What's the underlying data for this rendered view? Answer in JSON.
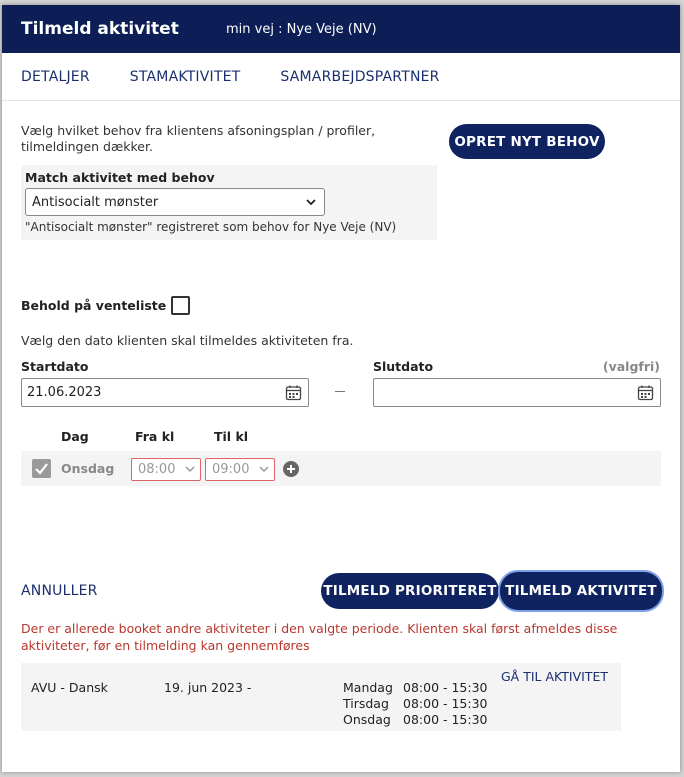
{
  "header": {
    "title": "Tilmeld aktivitet",
    "subtitle": "min vej : Nye Veje (NV)"
  },
  "tabs": [
    {
      "label": "DETALJER"
    },
    {
      "label": "STAMAKTIVITET"
    },
    {
      "label": "SAMARBEJDSPARTNER"
    }
  ],
  "intro_text": "Vælg hvilket behov fra klientens afsoningsplan / profiler, tilmeldingen dækker.",
  "match": {
    "label": "Match aktivitet med behov",
    "selected": "Antisocialt mønster",
    "note": "\"Antisocialt mønster\" registreret som behov for Nye Veje (NV)"
  },
  "opret_button": "OPRET NYT BEHOV",
  "venteliste_label": "Behold på venteliste",
  "dato_intro": "Vælg den dato klienten skal tilmeldes aktiviteten fra.",
  "startdato": {
    "label": "Startdato",
    "value": "21.06.2023"
  },
  "slutdato": {
    "label": "Slutdato",
    "value": "",
    "optional": "(valgfri)"
  },
  "dash": "–",
  "schedule": {
    "headers": {
      "dag": "Dag",
      "fra": "Fra kl",
      "til": "Til kl"
    },
    "row": {
      "dag": "Onsdag",
      "fra": "08:00",
      "til": "09:00",
      "checked": true
    }
  },
  "footer": {
    "annuller": "ANNULLER",
    "prioriteret": "TILMELD PRIORITERET",
    "tilmeld": "TILMELD AKTIVITET"
  },
  "warning": "Der er allerede booket andre aktiviteter i den valgte periode. Klienten skal først afmeldes disse aktiviteter, før en tilmelding kan gennemføres",
  "booked": {
    "activity": "AVU - Dansk",
    "date": "19. jun 2023 -",
    "days": [
      {
        "day": "Mandag",
        "time": "08:00 - 15:30"
      },
      {
        "day": "Tirsdag",
        "time": "08:00 - 15:30"
      },
      {
        "day": "Onsdag",
        "time": "08:00 - 15:30"
      }
    ],
    "link": "GÅ TIL AKTIVITET"
  },
  "colors": {
    "header_bg": "#0c1e55",
    "primary": "#0f2360",
    "link": "#1b2f6e",
    "warning": "#b8382e"
  }
}
